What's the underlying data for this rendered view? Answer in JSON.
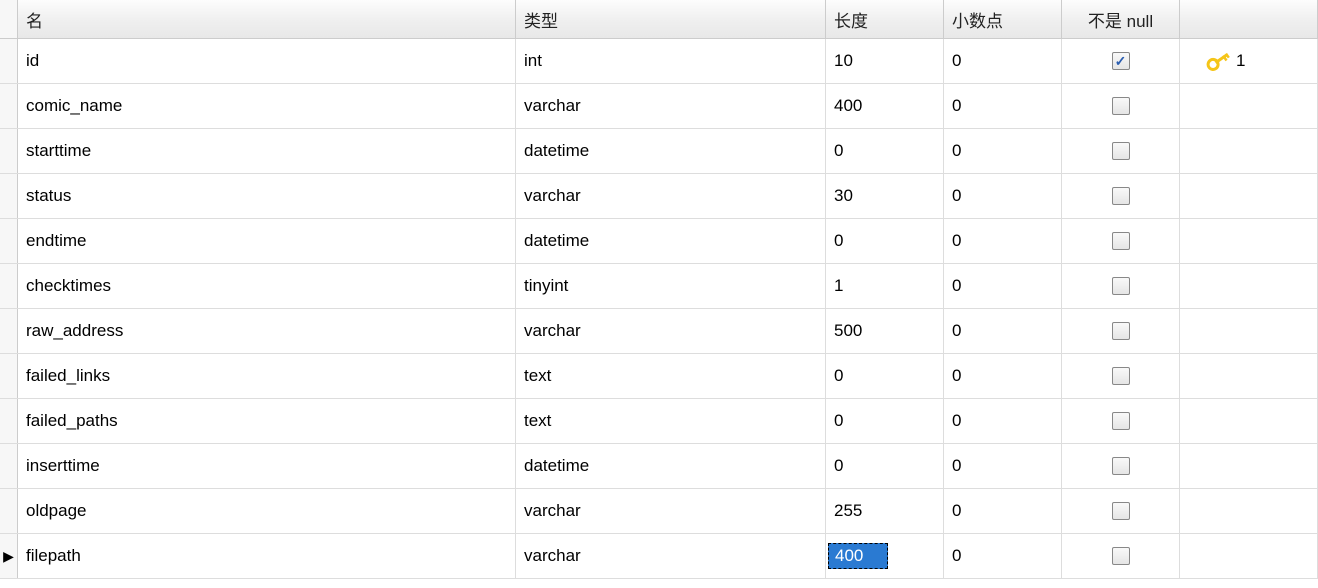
{
  "headers": {
    "name": "名",
    "type": "类型",
    "length": "长度",
    "decimals": "小数点",
    "notnull": "不是 null",
    "key": ""
  },
  "rows": [
    {
      "name": "id",
      "type": "int",
      "length": "10",
      "decimals": "0",
      "notnull": true,
      "pk": "1",
      "active": false,
      "selected_col": null
    },
    {
      "name": "comic_name",
      "type": "varchar",
      "length": "400",
      "decimals": "0",
      "notnull": false,
      "pk": "",
      "active": false,
      "selected_col": null
    },
    {
      "name": "starttime",
      "type": "datetime",
      "length": "0",
      "decimals": "0",
      "notnull": false,
      "pk": "",
      "active": false,
      "selected_col": null
    },
    {
      "name": "status",
      "type": "varchar",
      "length": "30",
      "decimals": "0",
      "notnull": false,
      "pk": "",
      "active": false,
      "selected_col": null
    },
    {
      "name": "endtime",
      "type": "datetime",
      "length": "0",
      "decimals": "0",
      "notnull": false,
      "pk": "",
      "active": false,
      "selected_col": null
    },
    {
      "name": "checktimes",
      "type": "tinyint",
      "length": "1",
      "decimals": "0",
      "notnull": false,
      "pk": "",
      "active": false,
      "selected_col": null
    },
    {
      "name": "raw_address",
      "type": "varchar",
      "length": "500",
      "decimals": "0",
      "notnull": false,
      "pk": "",
      "active": false,
      "selected_col": null
    },
    {
      "name": "failed_links",
      "type": "text",
      "length": "0",
      "decimals": "0",
      "notnull": false,
      "pk": "",
      "active": false,
      "selected_col": null
    },
    {
      "name": "failed_paths",
      "type": "text",
      "length": "0",
      "decimals": "0",
      "notnull": false,
      "pk": "",
      "active": false,
      "selected_col": null
    },
    {
      "name": "inserttime",
      "type": "datetime",
      "length": "0",
      "decimals": "0",
      "notnull": false,
      "pk": "",
      "active": false,
      "selected_col": null
    },
    {
      "name": "oldpage",
      "type": "varchar",
      "length": "255",
      "decimals": "0",
      "notnull": false,
      "pk": "",
      "active": false,
      "selected_col": null
    },
    {
      "name": "filepath",
      "type": "varchar",
      "length": "400",
      "decimals": "0",
      "notnull": false,
      "pk": "",
      "active": true,
      "selected_col": "length"
    }
  ]
}
